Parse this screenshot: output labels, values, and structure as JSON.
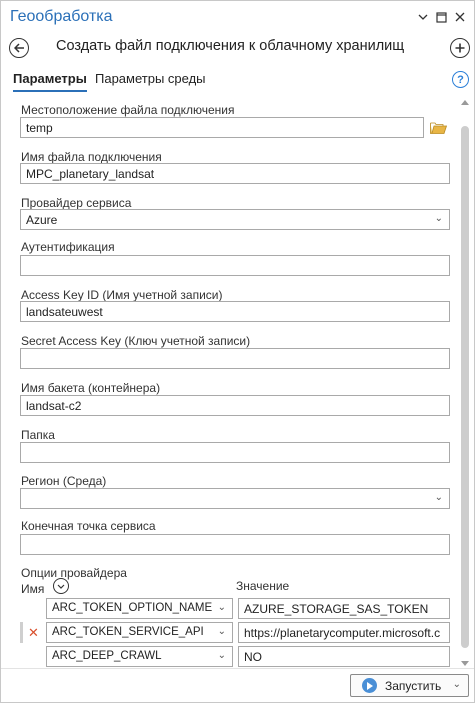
{
  "titlebar": {
    "title": "Геообработка",
    "menu_icon": "chevron-down-icon",
    "pin_icon": "restore-icon",
    "close_icon": "close-icon"
  },
  "tool": {
    "title": "Создать файл подключения к облачному хранилищ"
  },
  "tabs": [
    {
      "label": "Параметры",
      "active": true
    },
    {
      "label": "Параметры среды",
      "active": false
    }
  ],
  "help": {
    "glyph": "?"
  },
  "params": {
    "location": {
      "label": "Местоположение файла подключения",
      "value": "temp"
    },
    "file_name": {
      "label": "Имя файла подключения",
      "value": "MPC_planetary_landsat"
    },
    "provider": {
      "label": "Провайдер сервиса",
      "value": "Azure"
    },
    "auth": {
      "label": "Аутентификация",
      "value": ""
    },
    "access_key": {
      "label": "Access Key ID (Имя учетной записи)",
      "value": "landsateuwest"
    },
    "secret_key": {
      "label": "Secret Access Key (Ключ учетной записи)",
      "value": ""
    },
    "bucket": {
      "label": "Имя бакета (контейнера)",
      "value": "landsat-c2"
    },
    "folder": {
      "label": "Папка",
      "value": ""
    },
    "region": {
      "label": "Регион (Среда)",
      "value": ""
    },
    "endpoint": {
      "label": "Конечная точка сервиса",
      "value": ""
    },
    "options": {
      "label": "Опции провайдера",
      "col_name": "Имя",
      "col_value": "Значение",
      "rows": [
        {
          "name": "ARC_TOKEN_OPTION_NAME",
          "value": "AZURE_STORAGE_SAS_TOKEN"
        },
        {
          "name": "ARC_TOKEN_SERVICE_API",
          "value": "https://planetarycomputer.microsoft.c"
        },
        {
          "name": "ARC_DEEP_CRAWL",
          "value": "NO"
        }
      ],
      "delete_glyph": "✕"
    }
  },
  "footer": {
    "run_label": "Запустить"
  },
  "colors": {
    "accent": "#2b70b8",
    "run_icon": "#4a8fd6",
    "delete": "#d9502d"
  }
}
